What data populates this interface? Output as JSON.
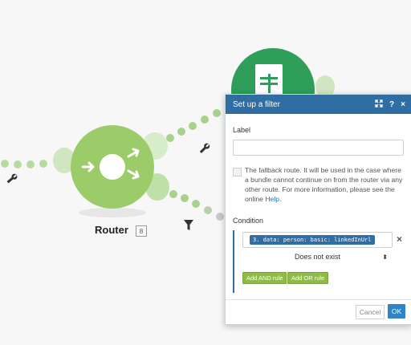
{
  "router": {
    "label": "Router",
    "badge": "8"
  },
  "dialog": {
    "title": "Set up a filter",
    "header_icons": {
      "expand": "expand-icon",
      "help": "?",
      "close": "×"
    },
    "label_field": {
      "label": "Label",
      "value": ""
    },
    "fallback": {
      "text": "The fallback route. It will be used in the case where a bundle cannot continue on from the router via any other route. For more information, please see the online",
      "link": "Help",
      "period": "."
    },
    "condition": {
      "label": "Condition",
      "field_chip": "3. data: person: basic: linkedInUrl",
      "operator": "Does not exist",
      "add_and": "Add AND rule",
      "add_or": "Add OR rule",
      "remove": "×"
    },
    "buttons": {
      "cancel": "Cancel",
      "ok": "OK"
    }
  },
  "colors": {
    "header": "#2f6da3",
    "module_green": "#9ccc6a",
    "sheets_green": "#2e9e58",
    "dots": "#a9d18e",
    "rule_buttons": "#8ebc44"
  }
}
